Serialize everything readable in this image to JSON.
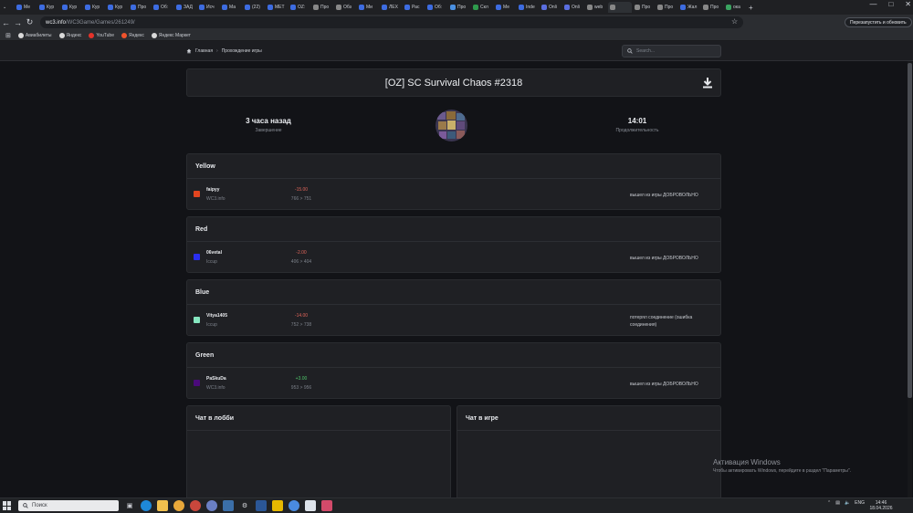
{
  "browser": {
    "tabs": [
      "Ме",
      "Кур",
      "Кур",
      "Кур",
      "Кур",
      "Про",
      "Об:",
      "ЗАД",
      "Исч",
      "Ма",
      "(22)",
      "МЕТ",
      "OZ:",
      "Про",
      "Обз",
      "Ми",
      "ЛЕХ",
      "Рас",
      "Об:",
      "Про",
      "Скл",
      "Ме",
      "Inde",
      "Onli",
      "Onli",
      "web",
      "",
      "Про",
      "Про",
      "Жал",
      "Про",
      "ока"
    ],
    "active_tab_index": 26,
    "url_host": "wc3.info",
    "url_path": "/WC3Game/Games/261249/",
    "update_button": "Перезапустить и обновить",
    "bookmarks": [
      {
        "label": "Авиабилеты",
        "color": "#d9d9d9"
      },
      {
        "label": "Яндекс",
        "color": "#d9d9d9"
      },
      {
        "label": "YouTube",
        "color": "#e5332a"
      },
      {
        "label": "Яндекс",
        "color": "#f0532c"
      },
      {
        "label": "Яндекс Маркет",
        "color": "#d9d9d9"
      }
    ]
  },
  "site": {
    "breadcrumb": {
      "home": "Главная",
      "current": "Прохождение игры"
    },
    "search_placeholder": "Search..."
  },
  "game": {
    "title": "[OZ] SC Survival Chaos #2318",
    "finished_value": "3 часа назад",
    "finished_label": "Завершение",
    "duration_value": "14:01",
    "duration_label": "Продолжительность"
  },
  "teams": [
    {
      "name": "Yellow",
      "player": "faipyy",
      "server": "WC3.info",
      "delta": "-15.00",
      "range": "766 > 751",
      "reason": "вышел из игры ДОБРОВОЛЬНО",
      "color": "#e2451f",
      "delta_type": "neg"
    },
    {
      "name": "Red",
      "player": "06vetal",
      "server": "Iccup",
      "delta": "-2.00",
      "range": "406 > 404",
      "reason": "вышел из игры ДОБРОВОЛЬНО",
      "color": "#2a2ef0",
      "delta_type": "neg"
    },
    {
      "name": "Blue",
      "player": "Vitya1405",
      "server": "Iccup",
      "delta": "-14.00",
      "range": "752 > 738",
      "reason": "потерял соединение (ошибка соединения)",
      "color": "#86e6c0",
      "delta_type": "neg"
    },
    {
      "name": "Green",
      "player": "PaSkuDa",
      "server": "WC3.info",
      "delta": "+3.00",
      "range": "953 > 956",
      "reason": "вышел из игры ДОБРОВОЛЬНО",
      "color": "#4a0a7a",
      "delta_type": "pos"
    }
  ],
  "chat": {
    "lobby_title": "Чат в лобби",
    "game_title": "Чат в игре"
  },
  "watermark": {
    "line1": "Активация Windows",
    "line2": "Чтобы активировать Windows, перейдите в раздел \"Параметры\"."
  },
  "taskbar": {
    "search_label": "Поиск",
    "lang": "ENG",
    "time": "14:46",
    "date": "18.04.2026"
  }
}
